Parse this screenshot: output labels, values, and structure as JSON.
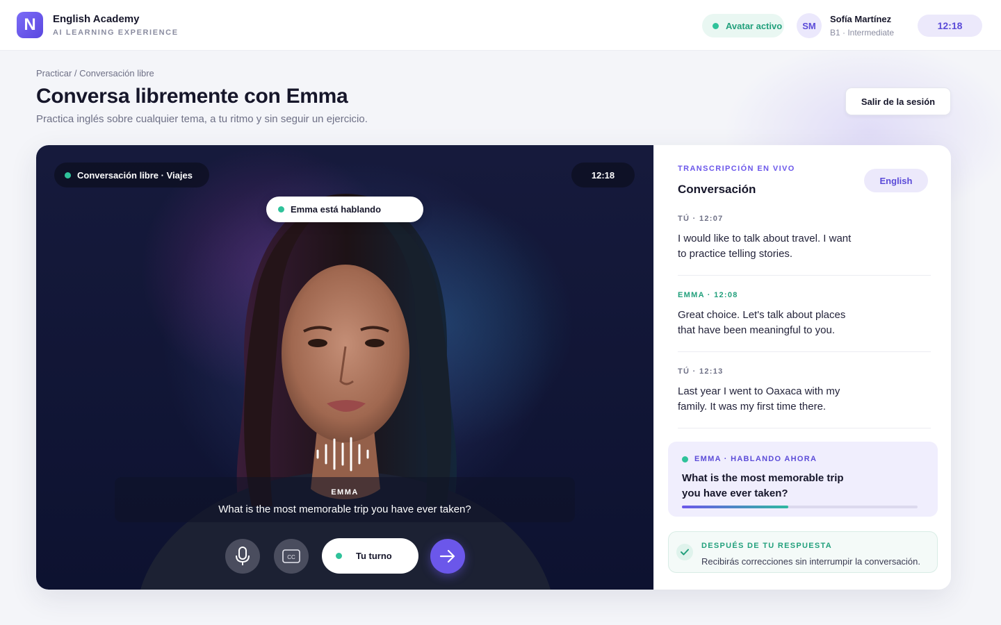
{
  "app": {
    "logo_letter": "N",
    "title": "English Academy",
    "subtitle": "AI LEARNING EXPERIENCE"
  },
  "header": {
    "status_label": "Avatar activo",
    "user_initials": "SM",
    "user_name": "Sofía Martínez",
    "user_level": "B1 · Intermediate",
    "clock": "12:18"
  },
  "page": {
    "breadcrumb": "Practicar / Conversación libre",
    "title": "Conversa libremente con Emma",
    "subtitle": "Practica inglés sobre cualquier tema, a tu ritmo y sin seguir un ejercicio.",
    "exit_label": "Salir de la sesión"
  },
  "video": {
    "topic_label": "Conversación libre · Viajes",
    "timer": "12:18",
    "speaking_label": "Emma está hablando",
    "caption_speaker": "EMMA",
    "caption_text": "What is the most memorable trip you have ever taken?",
    "mic_icon": "microphone-icon",
    "cc_icon": "closed-captions-icon",
    "cc_text": "CC",
    "turn_label": "Tu turno",
    "send_icon": "arrow-right-icon"
  },
  "transcript": {
    "kicker": "TRANSCRIPCIÓN EN VIVO",
    "title": "Conversación",
    "language": "English",
    "messages": [
      {
        "meta": "TÚ · 12:07",
        "text": "I would like to talk about travel. I want to practice telling stories."
      },
      {
        "meta": "EMMA · 12:08",
        "text": "Great choice. Let's talk about places that have been meaningful to you."
      },
      {
        "meta": "TÚ · 12:13",
        "text": "Last year I went to Oaxaca with my family. It was my first time there."
      }
    ],
    "now": {
      "meta": "EMMA · HABLANDO AHORA",
      "text": "What is the most memorable trip you have ever taken?",
      "progress": 0.45
    },
    "after": {
      "title": "DESPUÉS DE TU RESPUESTA",
      "text": "Recibirás correcciones sin interrumpir la conversación."
    }
  },
  "colors": {
    "accent": "#6b57ea",
    "accent_soft": "#ece9fb",
    "success": "#2fc29a",
    "success_text": "#22a07c",
    "text_dark": "#16162a",
    "text_muted": "#6e7086"
  }
}
